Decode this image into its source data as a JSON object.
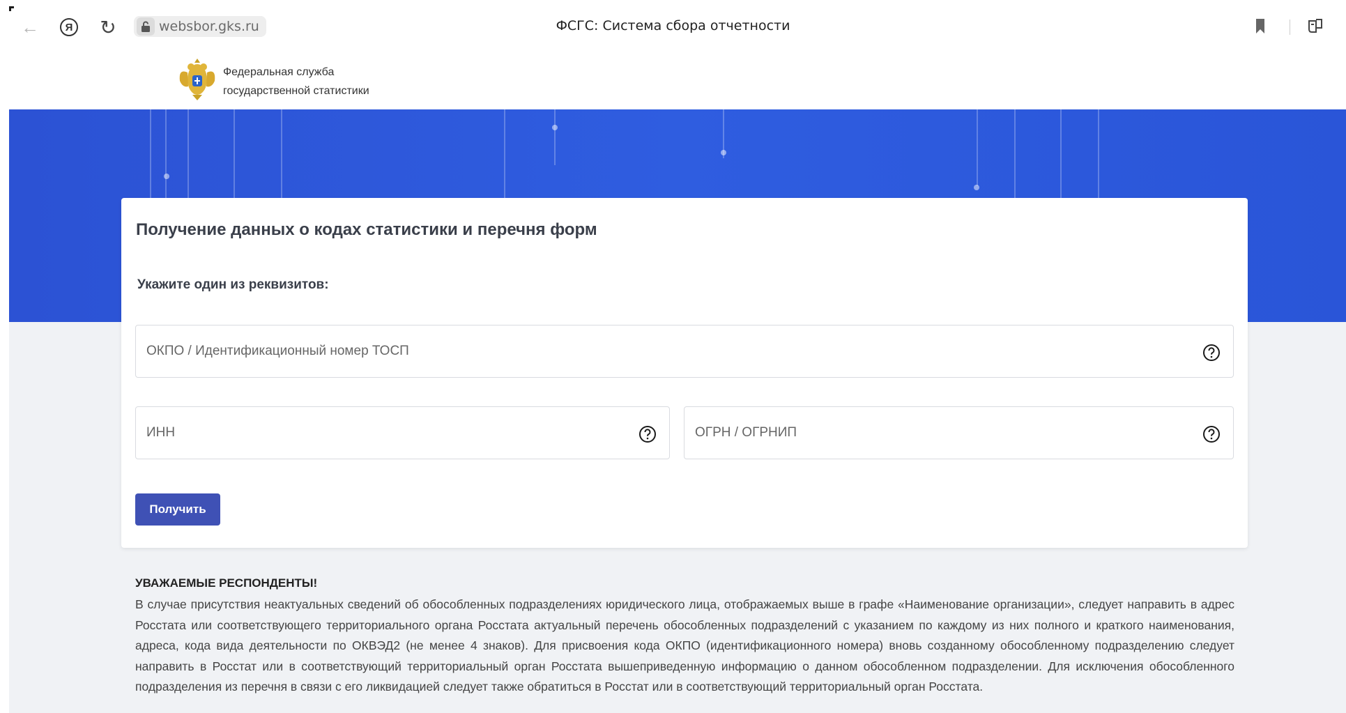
{
  "browser": {
    "url": "websbor.gks.ru",
    "tab_title": "ФСГС: Система сбора отчетности",
    "ya_glyph": "Я"
  },
  "header": {
    "org_line1": "Федеральная служба",
    "org_line2": "государственной статистики"
  },
  "form": {
    "title": "Получение данных о кодах статистики и перечня форм",
    "subtitle": "Укажите один из реквизитов:",
    "okpo_placeholder": "ОКПО / Идентификационный номер ТОСП",
    "inn_placeholder": "ИНН",
    "ogrn_placeholder": "ОГРН / ОГРНИП",
    "submit_label": "Получить"
  },
  "notice": {
    "heading": "УВАЖАЕМЫЕ РЕСПОНДЕНТЫ!",
    "text": "В случае присутствия неактуальных сведений об обособленных подразделениях юридического лица, отображаемых выше в графе «Наименование организации», следует направить в адрес Росстата или соответствующего территориального органа Росстата актуальный перечень обособленных подразделений с указанием по каждому из них полного и краткого наименования, адреса, кода вида деятельности по ОКВЭД2 (не менее 4 знаков). Для присвоения кода ОКПО (идентификационного номера) вновь созданному обособленному подразделению следует направить в Росстат или в соответствующий территориальный орган Росстата вышеприведенную информацию о данном обособленном подразделении. Для исключения обособленного подразделения из перечня в связи с его ликвидацией следует также обратиться в Росстат или в соответствующий территориальный орган Росстата."
  },
  "colors": {
    "hero_blue": "#2f5de0",
    "button_blue": "#3f51b5",
    "page_background": "#f0f2f5"
  }
}
